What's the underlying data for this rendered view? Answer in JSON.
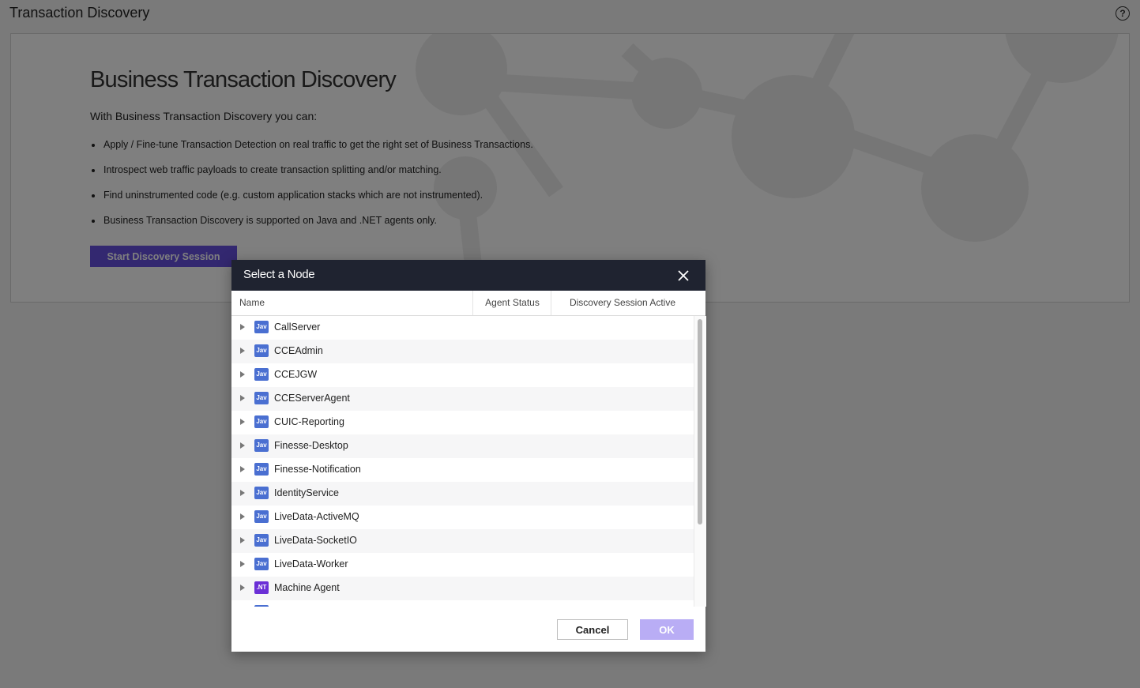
{
  "page": {
    "title": "Transaction Discovery",
    "help_icon_glyph": "?"
  },
  "panel": {
    "heading": "Business Transaction Discovery",
    "intro": "With Business Transaction Discovery you can:",
    "bullets": [
      "Apply / Fine-tune Transaction Detection on real traffic to get the right set of Business Transactions.",
      "Introspect web traffic payloads to create transaction splitting and/or matching.",
      "Find uninstrumented code (e.g. custom application stacks which are not instrumented).",
      "Business Transaction Discovery is supported on Java and .NET agents only."
    ],
    "start_button": "Start Discovery Session"
  },
  "dialog": {
    "title": "Select a Node",
    "columns": {
      "name": "Name",
      "agent_status": "Agent Status",
      "session_active": "Discovery Session Active"
    },
    "nodes": [
      {
        "name": "CallServer",
        "badge": "Jav"
      },
      {
        "name": "CCEAdmin",
        "badge": "Jav"
      },
      {
        "name": "CCEJGW",
        "badge": "Jav"
      },
      {
        "name": "CCEServerAgent",
        "badge": "Jav"
      },
      {
        "name": "CUIC-Reporting",
        "badge": "Jav"
      },
      {
        "name": "Finesse-Desktop",
        "badge": "Jav"
      },
      {
        "name": "Finesse-Notification",
        "badge": "Jav"
      },
      {
        "name": "IdentityService",
        "badge": "Jav"
      },
      {
        "name": "LiveData-ActiveMQ",
        "badge": "Jav"
      },
      {
        "name": "LiveData-SocketIO",
        "badge": "Jav"
      },
      {
        "name": "LiveData-Worker",
        "badge": "Jav"
      },
      {
        "name": "Machine Agent",
        "badge": ".NT"
      }
    ],
    "cancel_button": "Cancel",
    "ok_button": "OK"
  },
  "colors": {
    "accent": "#6650e0",
    "ok_disabled": "#b9adf5",
    "dialog_header": "#1f2330",
    "java_badge": "#4a6fd1",
    "dotnet_badge": "#6b2fd6"
  }
}
